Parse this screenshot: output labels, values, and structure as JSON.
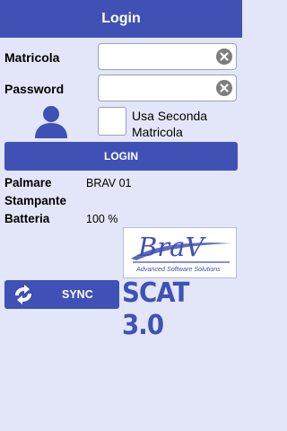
{
  "header": {
    "title": "Login"
  },
  "form": {
    "username_label": "Matricola",
    "username_value": "",
    "password_label": "Password",
    "password_value": "",
    "second_matricola_label": "Usa Seconda Matricola",
    "second_matricola_checked": false
  },
  "login_button": {
    "label": "LOGIN"
  },
  "info": [
    {
      "label": "Palmare",
      "value": "BRAV 01"
    },
    {
      "label": "Stampante",
      "value": ""
    },
    {
      "label": "Batteria",
      "value": "100 %"
    }
  ],
  "brand": {
    "logo_text": "BraV",
    "logo_tagline": "Advanced Software Solutions",
    "product_name": "SCAT 3.0"
  },
  "sync_button": {
    "label": "SYNC"
  },
  "colors": {
    "primary": "#3f51b5",
    "background": "#e3e6f9",
    "clear_icon": "#7d7d7d"
  },
  "icons": [
    "user-avatar-icon",
    "clear-icon",
    "sync-icon"
  ]
}
